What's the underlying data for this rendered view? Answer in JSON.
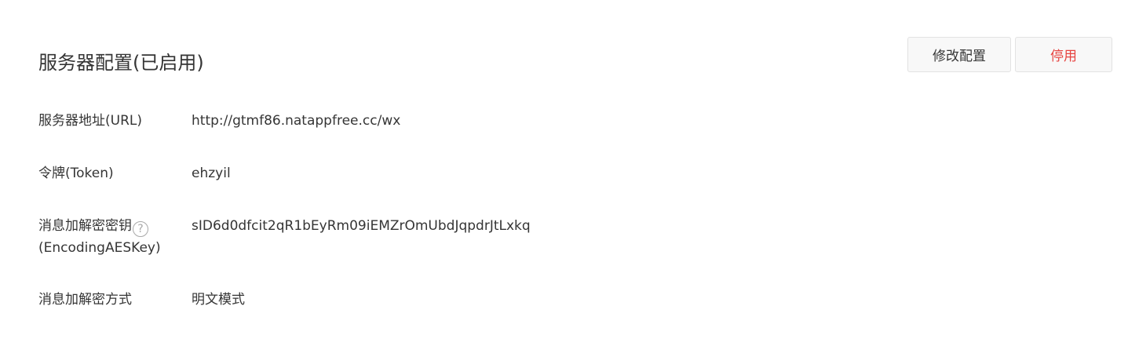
{
  "header": {
    "title": "服务器配置(已启用)",
    "edit_label": "修改配置",
    "disable_label": "停用"
  },
  "fields": {
    "url": {
      "label": "服务器地址(URL)",
      "value": "http://gtmf86.natappfree.cc/wx"
    },
    "token": {
      "label": "令牌(Token)",
      "value": "ehzyil"
    },
    "aeskey": {
      "label_line1": "消息加解密密钥",
      "label_line2": "(EncodingAESKey)",
      "help_glyph": "?",
      "value": "sID6d0dfcit2qR1bEyRm09iEMZrOmUbdJqpdrJtLxkq"
    },
    "encryption": {
      "label": "消息加解密方式",
      "value": "明文模式"
    }
  },
  "colors": {
    "text": "#353535",
    "danger": "#e64340",
    "button_bg": "#f8f8f8",
    "button_border": "#e2e2e2"
  }
}
